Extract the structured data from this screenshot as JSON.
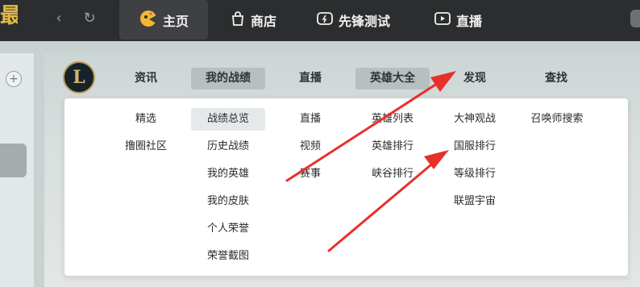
{
  "topbar": {
    "logo_text": "最",
    "back_icon": "chevron-left-icon",
    "refresh_icon": "refresh-icon",
    "tabs": [
      {
        "label": "主页",
        "icon": "home-icon"
      },
      {
        "label": "商店",
        "icon": "shop-bag-icon"
      },
      {
        "label": "先锋测试",
        "icon": "gamepad-icon"
      },
      {
        "label": "直播",
        "icon": "play-icon"
      }
    ],
    "active_tab": "主页"
  },
  "leftbar": {
    "plus_label": "+"
  },
  "game": {
    "logo_text": "L",
    "subnav": [
      "资讯",
      "我的战绩",
      "直播",
      "英雄大全",
      "发现",
      "查找"
    ],
    "subnav_highlighted": [
      "我的战绩",
      "英雄大全"
    ]
  },
  "dropdown": {
    "columns": [
      {
        "items": [
          "精选",
          "撸圈社区"
        ]
      },
      {
        "items": [
          "战绩总览",
          "历史战绩",
          "我的英雄",
          "我的皮肤",
          "个人荣誉",
          "荣誉截图"
        ],
        "selected": "战绩总览"
      },
      {
        "items": [
          "直播",
          "视频",
          "赛事"
        ]
      },
      {
        "items": [
          "英雄列表",
          "英雄排行",
          "峡谷排行"
        ]
      },
      {
        "items": [
          "大神观战",
          "国服排行",
          "等级排行",
          "联盟宇宙"
        ]
      },
      {
        "items": [
          "召唤师搜索"
        ]
      }
    ]
  },
  "annotation": {
    "arrow_color": "#e8302a",
    "arrows": 2
  }
}
